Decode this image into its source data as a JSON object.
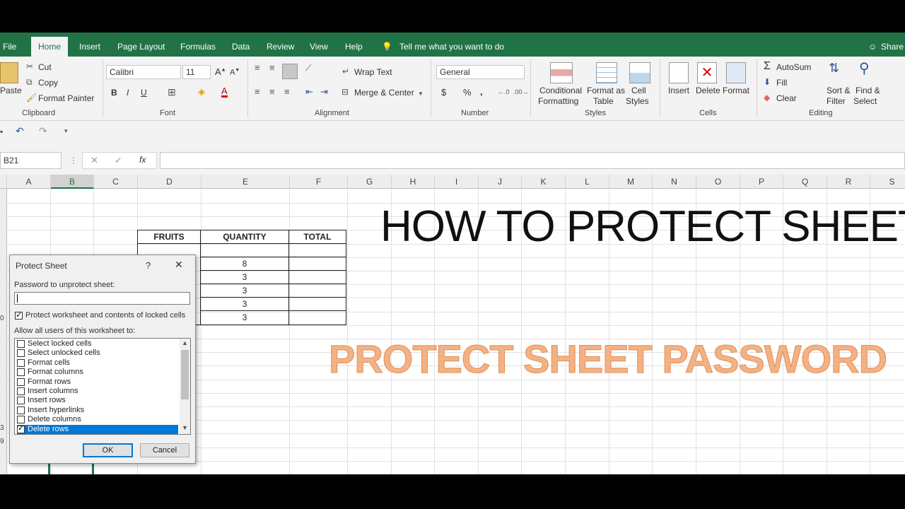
{
  "tabs": [
    "File",
    "Home",
    "Insert",
    "Page Layout",
    "Formulas",
    "Data",
    "Review",
    "View",
    "Help"
  ],
  "tell_me": "Tell me what you want to do",
  "share": "Share",
  "clipboard": {
    "paste": "Paste",
    "cut": "Cut",
    "copy": "Copy",
    "format_painter": "Format Painter",
    "label": "Clipboard"
  },
  "font": {
    "name": "Calibri",
    "size": "11",
    "bold": "B",
    "italic": "I",
    "underline": "U",
    "label": "Font"
  },
  "alignment": {
    "wrap": "Wrap Text",
    "merge": "Merge & Center",
    "label": "Alignment"
  },
  "number": {
    "format": "General",
    "currency": "$",
    "percent": "%",
    "comma": ",",
    "label": "Number"
  },
  "styles": {
    "cond1": "Conditional",
    "cond2": "Formatting",
    "fmt_table1": "Format as",
    "fmt_table2": "Table",
    "cell_styles1": "Cell",
    "cell_styles2": "Styles",
    "label": "Styles"
  },
  "cells": {
    "insert": "Insert",
    "delete": "Delete",
    "format": "Format",
    "label": "Cells"
  },
  "editing": {
    "autosum": "AutoSum",
    "fill": "Fill",
    "clear": "Clear",
    "sort1": "Sort &",
    "sort2": "Filter",
    "find1": "Find &",
    "find2": "Select",
    "label": "Editing"
  },
  "name_box": "B21",
  "fx": "fx",
  "columns": [
    "A",
    "B",
    "C",
    "D",
    "E",
    "F",
    "G",
    "H",
    "I",
    "J",
    "K",
    "L",
    "M",
    "N",
    "O",
    "P",
    "Q",
    "R",
    "S"
  ],
  "table": {
    "headers": [
      "FRUITS",
      "QUANTITY",
      "TOTAL"
    ],
    "quantities": [
      "8",
      "3",
      "3",
      "3",
      "3"
    ]
  },
  "overlay": {
    "title": "HOW TO PROTECT SHEET",
    "subtitle": "PROTECT SHEET PASSWORD"
  },
  "dialog": {
    "title": "Protect Sheet",
    "help": "?",
    "close": "✕",
    "password_label": "Password to unprotect sheet:",
    "protect_label": "Protect worksheet and contents of locked cells",
    "allow_label": "Allow all users of this worksheet to:",
    "items": [
      {
        "label": "Select locked cells",
        "checked": false
      },
      {
        "label": "Select unlocked cells",
        "checked": false
      },
      {
        "label": "Format cells",
        "checked": false
      },
      {
        "label": "Format columns",
        "checked": false
      },
      {
        "label": "Format rows",
        "checked": false
      },
      {
        "label": "Insert columns",
        "checked": false
      },
      {
        "label": "Insert rows",
        "checked": false
      },
      {
        "label": "Insert hyperlinks",
        "checked": false
      },
      {
        "label": "Delete columns",
        "checked": false
      },
      {
        "label": "Delete rows",
        "checked": true
      }
    ],
    "ok": "OK",
    "cancel": "Cancel"
  },
  "row_numbers_visible": [
    "0",
    "3",
    "9"
  ],
  "colors": {
    "excel_green": "#217346",
    "title_orange": "#f4b183",
    "selection_blue": "#0078d7"
  }
}
